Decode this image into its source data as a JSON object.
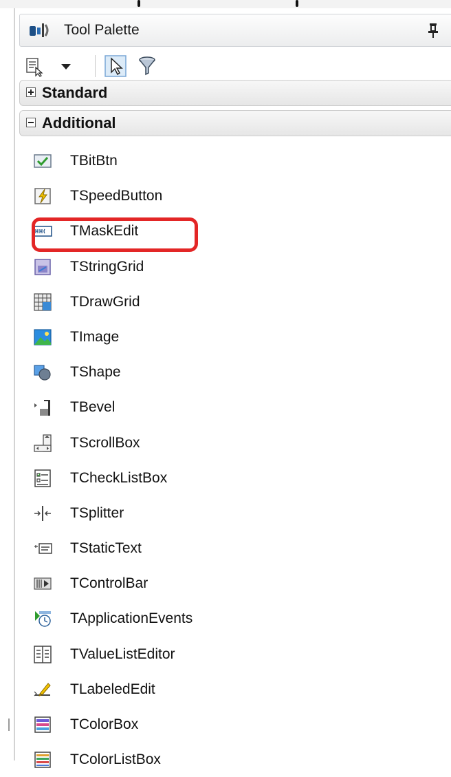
{
  "window": {
    "title": "Tool Palette",
    "icons": {
      "app": "tool-palette-icon",
      "pin": "pin-icon",
      "close": "close-icon"
    }
  },
  "toolbar": {
    "buttons": [
      {
        "icon": "categories-icon"
      },
      {
        "icon": "dropdown-arrow-icon"
      },
      {
        "icon": "pointer-icon"
      },
      {
        "icon": "filter-icon"
      }
    ]
  },
  "categories": [
    {
      "label": "Standard",
      "expanded": false
    },
    {
      "label": "Additional",
      "expanded": true
    }
  ],
  "components": [
    {
      "label": "TBitBtn",
      "icon": "bitbtn-icon"
    },
    {
      "label": "TSpeedButton",
      "icon": "speedbutton-icon"
    },
    {
      "label": "TMaskEdit",
      "icon": "maskedit-icon",
      "highlighted": true
    },
    {
      "label": "TStringGrid",
      "icon": "stringgrid-icon"
    },
    {
      "label": "TDrawGrid",
      "icon": "drawgrid-icon"
    },
    {
      "label": "TImage",
      "icon": "image-icon"
    },
    {
      "label": "TShape",
      "icon": "shape-icon"
    },
    {
      "label": "TBevel",
      "icon": "bevel-icon"
    },
    {
      "label": "TScrollBox",
      "icon": "scrollbox-icon"
    },
    {
      "label": "TCheckListBox",
      "icon": "checklistbox-icon"
    },
    {
      "label": "TSplitter",
      "icon": "splitter-icon"
    },
    {
      "label": "TStaticText",
      "icon": "statictext-icon"
    },
    {
      "label": "TControlBar",
      "icon": "controlbar-icon"
    },
    {
      "label": "TApplicationEvents",
      "icon": "applicationevents-icon"
    },
    {
      "label": "TValueListEditor",
      "icon": "valuelisteditor-icon"
    },
    {
      "label": "TLabeledEdit",
      "icon": "labelededit-icon"
    },
    {
      "label": "TColorBox",
      "icon": "colorbox-icon"
    },
    {
      "label": "TColorListBox",
      "icon": "colorlistbox-icon"
    }
  ],
  "colors": {
    "highlight": "#e32626",
    "category_bg": "#e9e9e9"
  }
}
